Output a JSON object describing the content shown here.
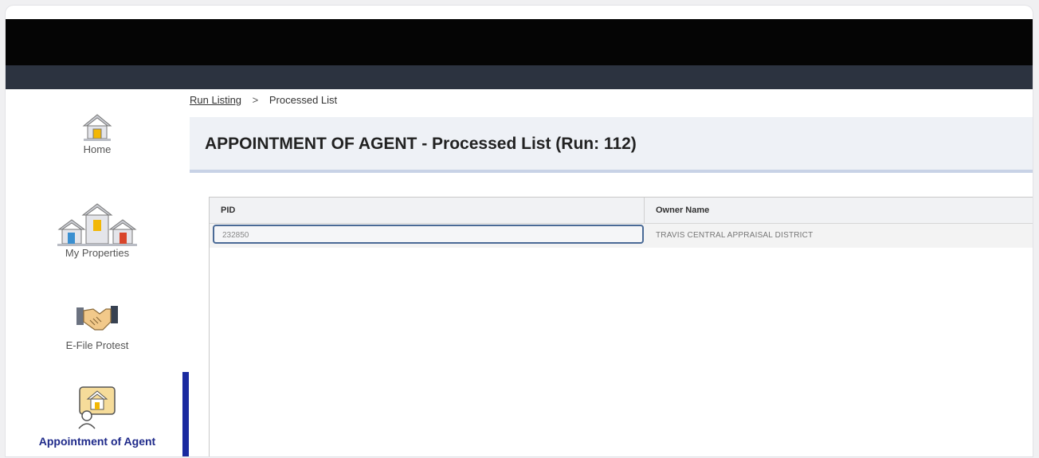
{
  "breadcrumb": {
    "link": "Run Listing",
    "separator": ">",
    "current": "Processed List"
  },
  "page": {
    "title": "APPOINTMENT OF AGENT - Processed List (Run: 112)"
  },
  "sidebar": {
    "items": [
      {
        "label": "Home",
        "icon": "home-icon"
      },
      {
        "label": "My Properties",
        "icon": "properties-icon"
      },
      {
        "label": "E-File Protest",
        "icon": "handshake-icon"
      },
      {
        "label": "Appointment of Agent",
        "icon": "agent-icon",
        "active": true
      }
    ]
  },
  "table": {
    "columns": [
      "PID",
      "Owner Name"
    ],
    "rows": [
      {
        "pid": "232850",
        "owner": "TRAVIS CENTRAL APPRAISAL DISTRICT"
      }
    ]
  },
  "colors": {
    "topbar": "#050505",
    "subbar": "#2c3340",
    "active_accent": "#1a2aa0",
    "title_band": "#eef1f6"
  }
}
